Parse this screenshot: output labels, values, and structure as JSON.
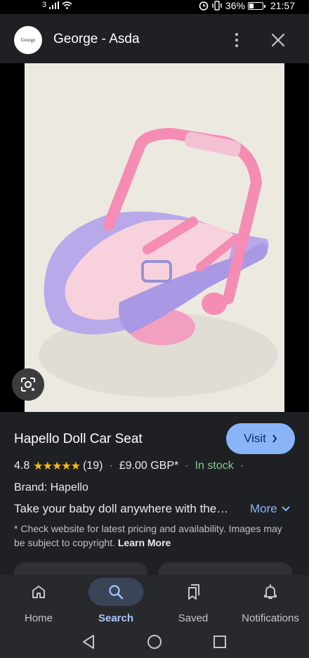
{
  "status_bar": {
    "signal_label": "3",
    "battery": "36%",
    "battery_level": 0.36,
    "time": "21:57"
  },
  "header": {
    "logo_text": "George",
    "site_name": "George - Asda"
  },
  "product": {
    "title": "Hapello Doll Car Seat",
    "visit_label": "Visit",
    "rating": "4.8",
    "stars": "★★★★★",
    "review_count": "(19)",
    "price": "£9.00 GBP*",
    "stock": "In stock",
    "brand": "Brand: Hapello",
    "description": "Take your baby doll anywhere with the…",
    "more_label": "More",
    "disclaimer_text": "* Check website for latest pricing and availability. Images may be subject to copyright.",
    "learn_more": "Learn More"
  },
  "bottom_nav": {
    "items": [
      {
        "label": "Home",
        "icon": "home-icon"
      },
      {
        "label": "Search",
        "icon": "search-icon",
        "active": true
      },
      {
        "label": "Saved",
        "icon": "bookmarks-icon"
      },
      {
        "label": "Notifications",
        "icon": "bell-icon"
      }
    ]
  },
  "colors": {
    "accent": "#8ab4f8",
    "star": "#fbbc04",
    "in_stock": "#81c995",
    "panel": "#1f2023"
  }
}
